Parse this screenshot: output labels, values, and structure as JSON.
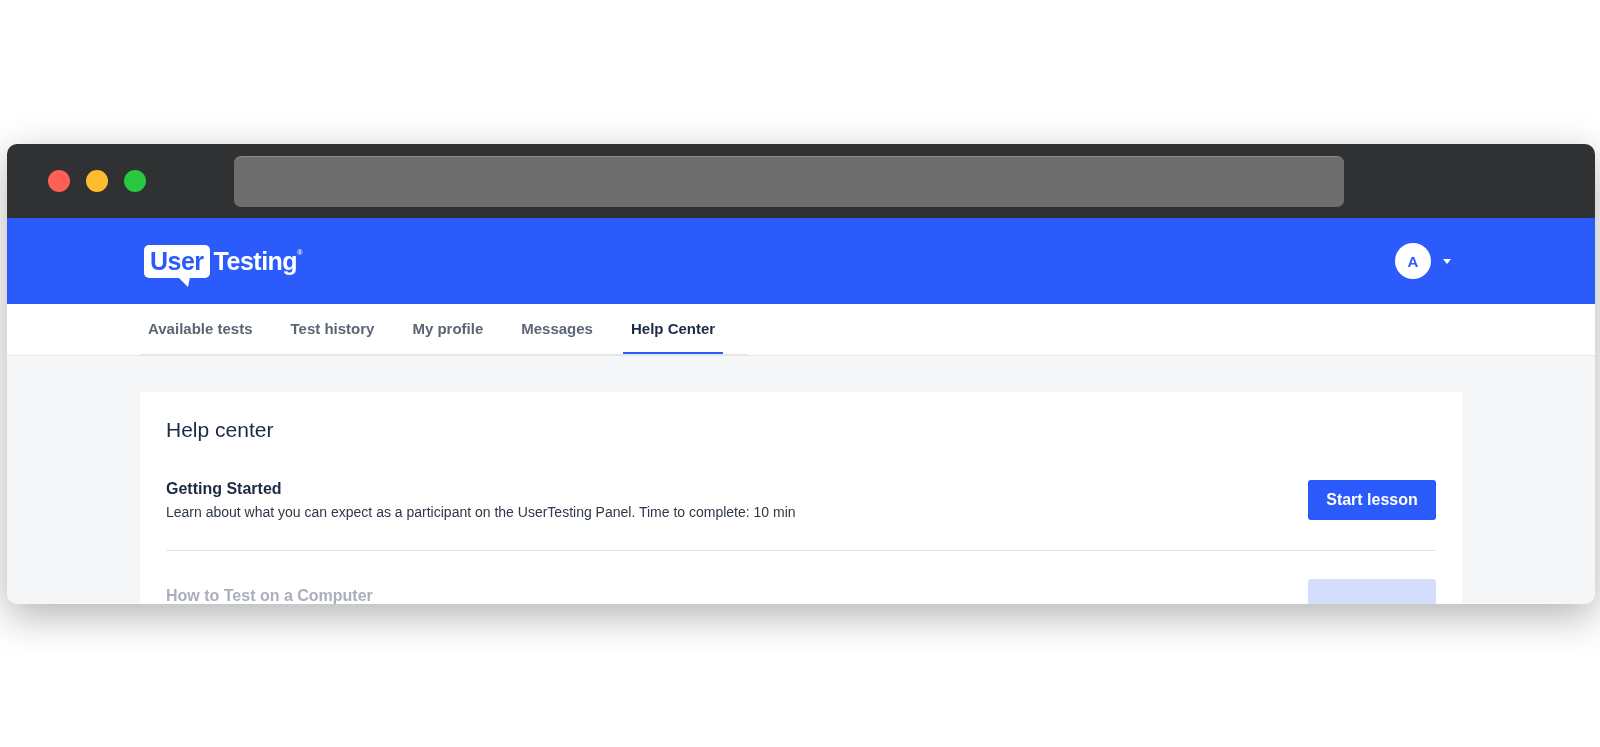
{
  "browser": {
    "traffic_lights": [
      {
        "color": "#fe5f57"
      },
      {
        "color": "#febc2e"
      },
      {
        "color": "#28c840"
      }
    ]
  },
  "header": {
    "logo": {
      "boxed": "User",
      "plain": "Testing",
      "mark": "®"
    },
    "avatar": "A"
  },
  "tabs": [
    {
      "label": "Available tests",
      "selected": false
    },
    {
      "label": "Test history",
      "selected": false
    },
    {
      "label": "My profile",
      "selected": false
    },
    {
      "label": "Messages",
      "selected": false
    },
    {
      "label": "Help Center",
      "selected": true
    }
  ],
  "help_center": {
    "title": "Help center",
    "lessons": [
      {
        "title": "Getting Started",
        "description": "Learn about what you can expect as a participant on the UserTesting Panel. Time to complete: 10 min",
        "button": "Start lesson",
        "faded": false
      },
      {
        "title": "How to Test on a Computer",
        "faded": true
      }
    ]
  }
}
